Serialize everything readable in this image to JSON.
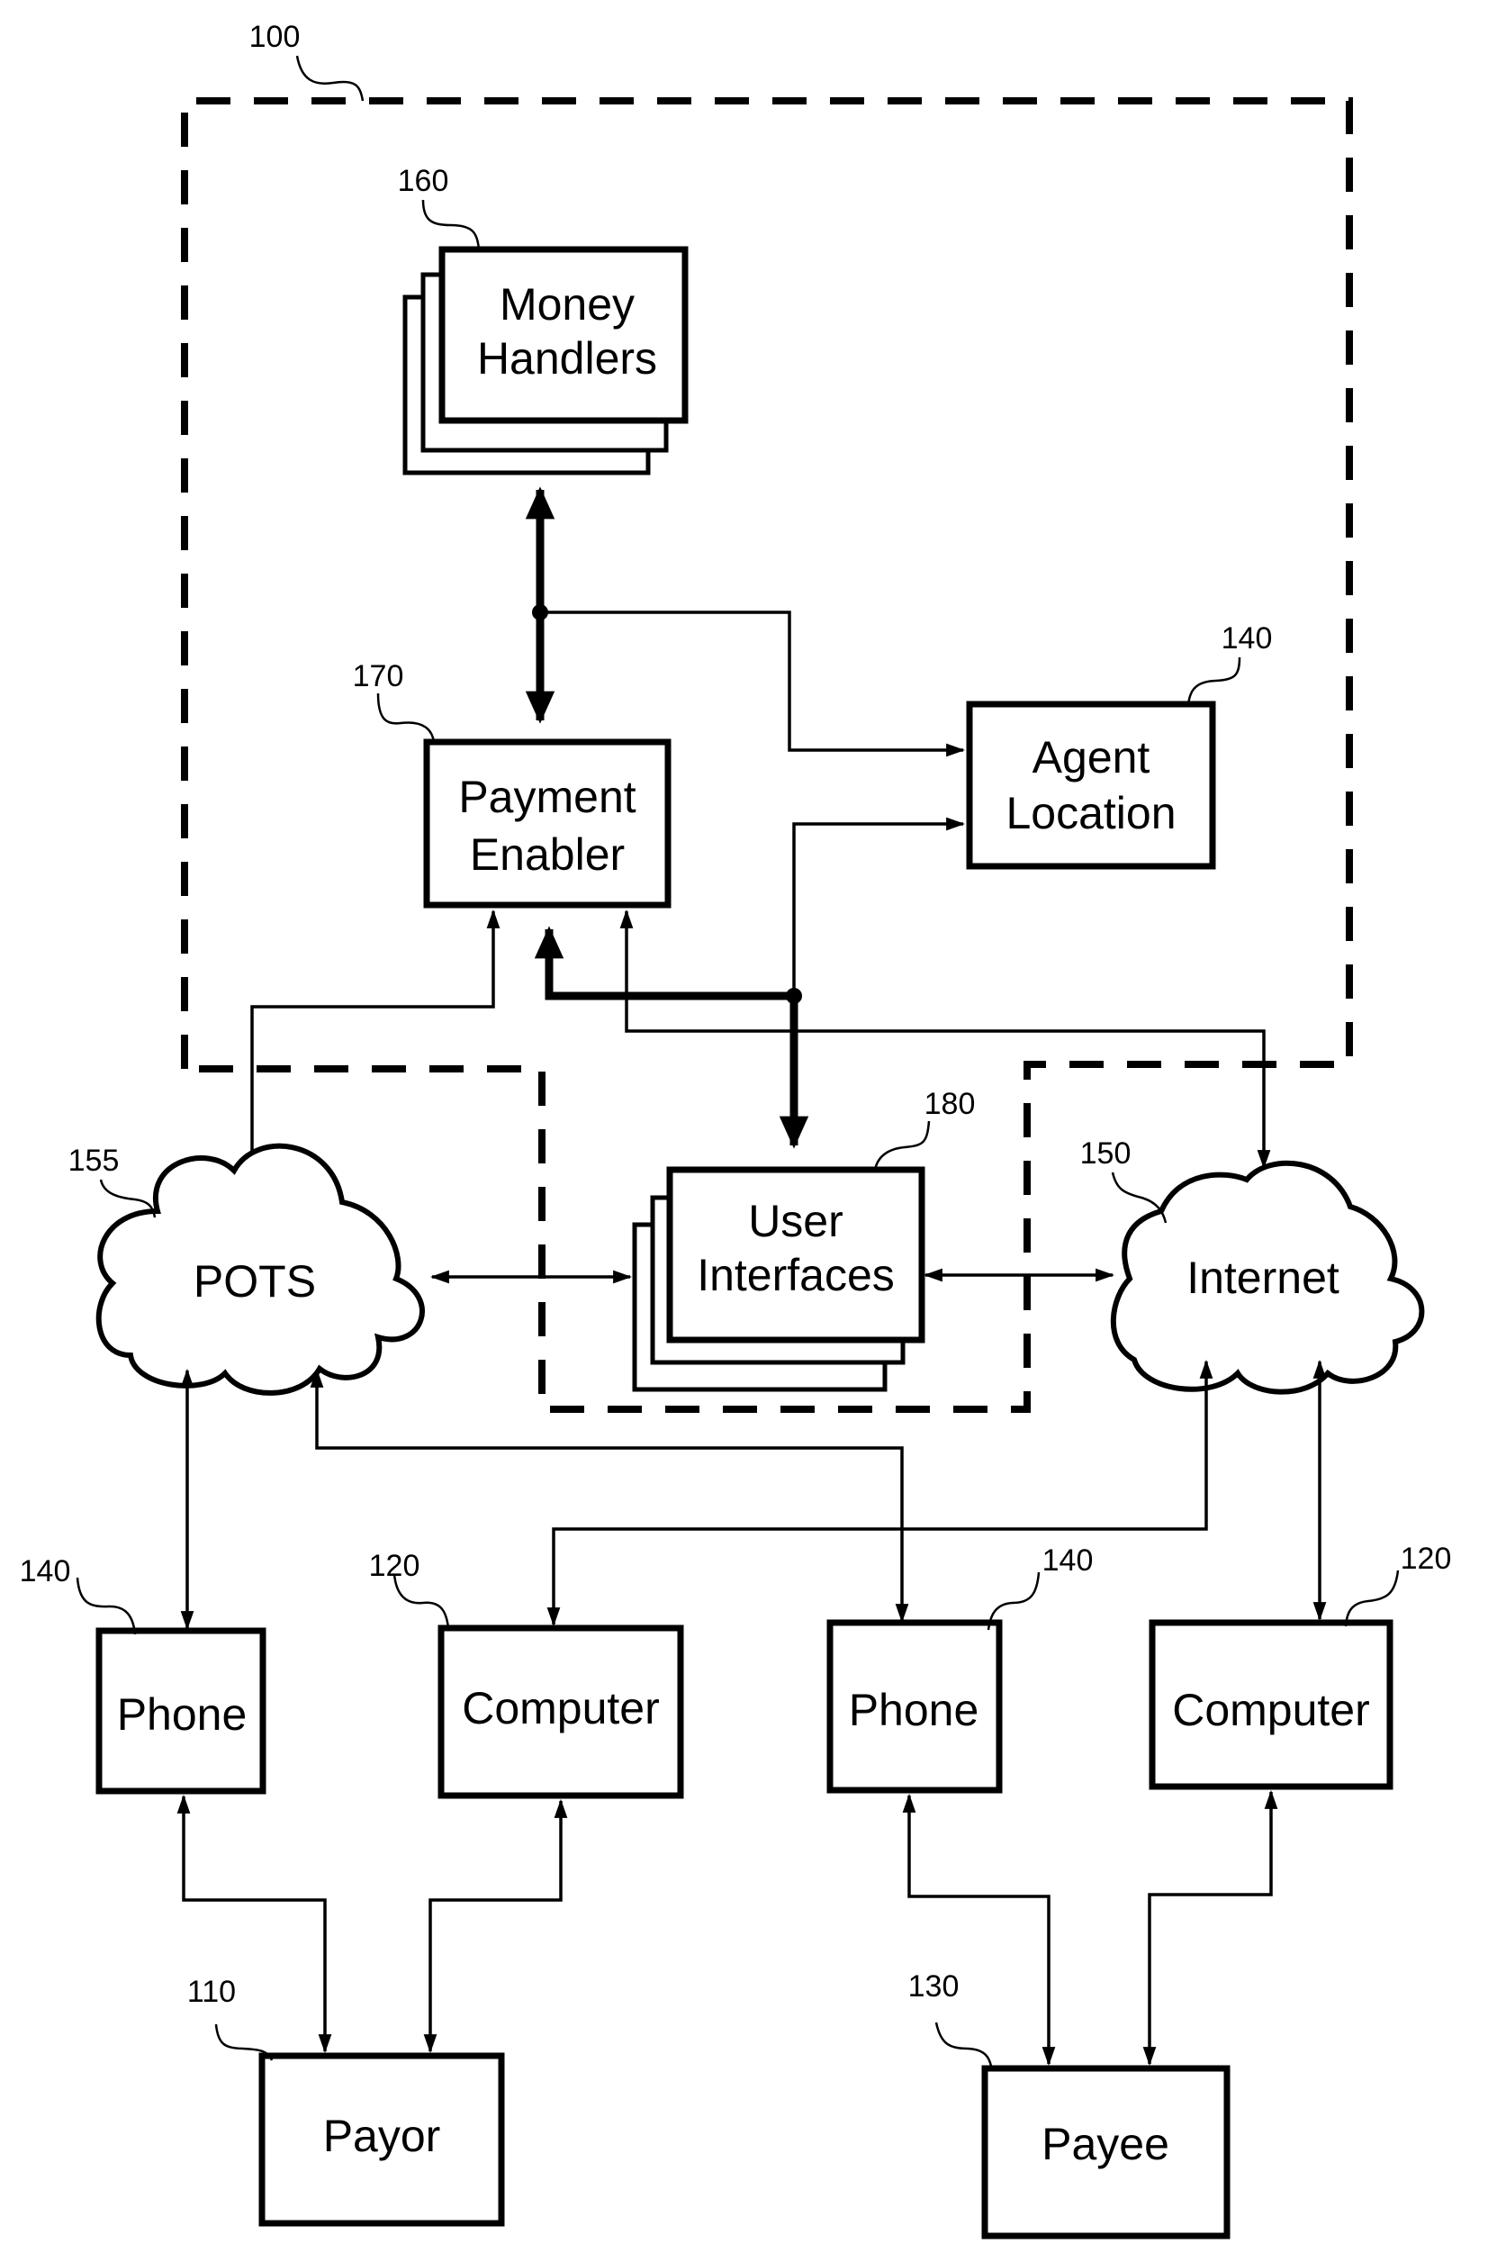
{
  "figure": {
    "system_ref": "100",
    "nodes": {
      "money_handlers": {
        "label_line1": "Money",
        "label_line2": "Handlers",
        "ref": "160"
      },
      "payment_enabler": {
        "label_line1": "Payment",
        "label_line2": "Enabler",
        "ref": "170"
      },
      "agent_location": {
        "label_line1": "Agent",
        "label_line2": "Location",
        "ref": "140"
      },
      "user_interfaces": {
        "label_line1": "User",
        "label_line2": "Interfaces",
        "ref": "180"
      },
      "pots": {
        "label": "POTS",
        "ref": "155"
      },
      "internet": {
        "label": "Internet",
        "ref": "150"
      },
      "payor_phone": {
        "label": "Phone",
        "ref": "140"
      },
      "payor_computer": {
        "label": "Computer",
        "ref": "120"
      },
      "payee_phone": {
        "label": "Phone",
        "ref": "140"
      },
      "payee_computer": {
        "label": "Computer",
        "ref": "120"
      },
      "payor": {
        "label": "Payor",
        "ref": "110"
      },
      "payee": {
        "label": "Payee",
        "ref": "130"
      }
    },
    "connections": [
      {
        "from": "money_handlers",
        "to": "payment_enabler",
        "type": "bidirectional-bus"
      },
      {
        "from": "money_handlers-bus",
        "to": "agent_location",
        "type": "arrow"
      },
      {
        "from": "user_interfaces-bus",
        "to": "agent_location",
        "type": "arrow"
      },
      {
        "from": "user_interfaces",
        "to": "payment_enabler",
        "type": "bidirectional-bus"
      },
      {
        "from": "pots",
        "to": "payment_enabler",
        "type": "bidirectional"
      },
      {
        "from": "internet",
        "to": "payment_enabler",
        "type": "bidirectional"
      },
      {
        "from": "pots",
        "to": "user_interfaces",
        "type": "bidirectional"
      },
      {
        "from": "user_interfaces",
        "to": "internet",
        "type": "bidirectional"
      },
      {
        "from": "pots",
        "to": "payor_phone",
        "type": "bidirectional"
      },
      {
        "from": "pots",
        "to": "payee_phone",
        "type": "bidirectional"
      },
      {
        "from": "internet",
        "to": "payor_computer",
        "type": "bidirectional"
      },
      {
        "from": "internet",
        "to": "payee_computer",
        "type": "bidirectional"
      },
      {
        "from": "payor_phone",
        "to": "payor",
        "type": "bidirectional"
      },
      {
        "from": "payor_computer",
        "to": "payor",
        "type": "bidirectional"
      },
      {
        "from": "payee_phone",
        "to": "payee",
        "type": "bidirectional"
      },
      {
        "from": "payee_computer",
        "to": "payee",
        "type": "bidirectional"
      }
    ]
  }
}
